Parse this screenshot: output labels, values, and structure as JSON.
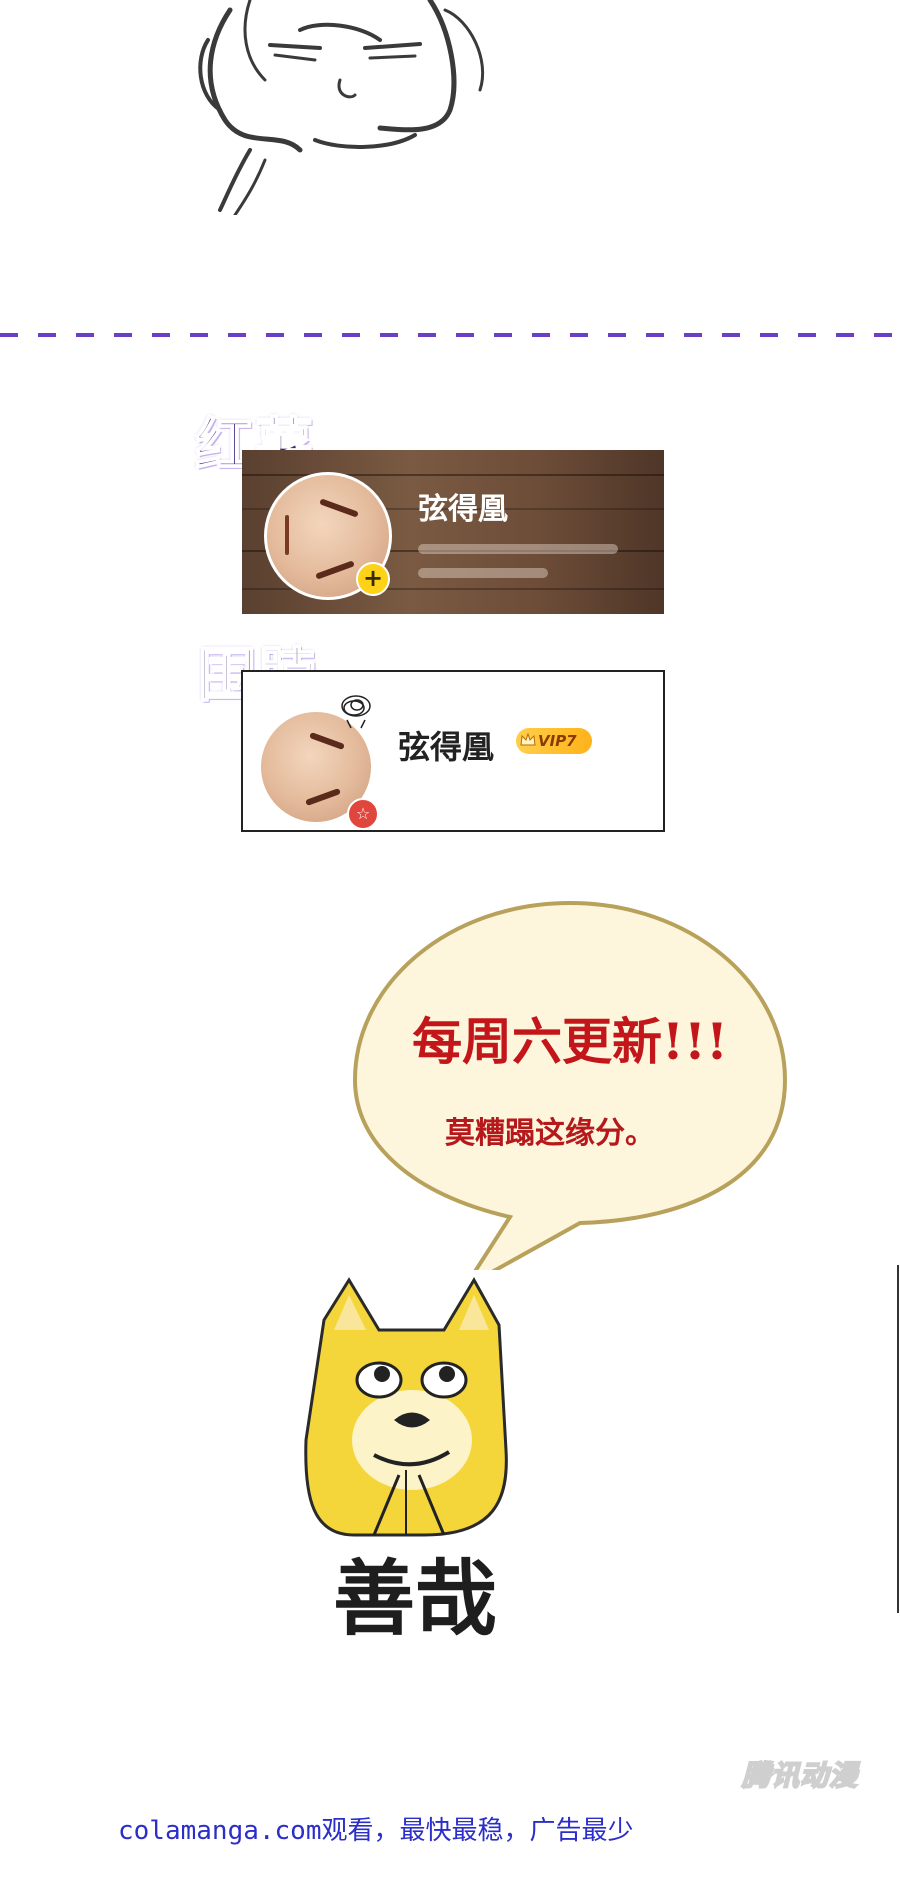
{
  "top_sketch": {
    "icon": "sketched-face-illustration"
  },
  "divider": {
    "style": "dashed",
    "color": "#6a3fc8"
  },
  "section_hongshu": {
    "tag_label": "红薯",
    "profile": {
      "name": "弦得凰",
      "add_icon": "plus-icon",
      "avatar": "anime-face-avatar"
    }
  },
  "section_weibo": {
    "tag_label": "围脖",
    "profile": {
      "name": "弦得凰",
      "vip_badge": "VIP7",
      "avatar": "anime-face-avatar",
      "verified_icon": "star-icon"
    }
  },
  "speech_bubble": {
    "title": "每周六更新!!!",
    "subtitle": "莫糟蹋这缘分。",
    "fill_color": "#fdf6dc",
    "border_color": "#b8a15a"
  },
  "meme": {
    "image": "doge-praying-icon",
    "caption": "善哉"
  },
  "watermark": {
    "text": "腾讯动漫"
  },
  "footer": {
    "text": "colamanga.com观看，最快最稳，广告最少"
  }
}
